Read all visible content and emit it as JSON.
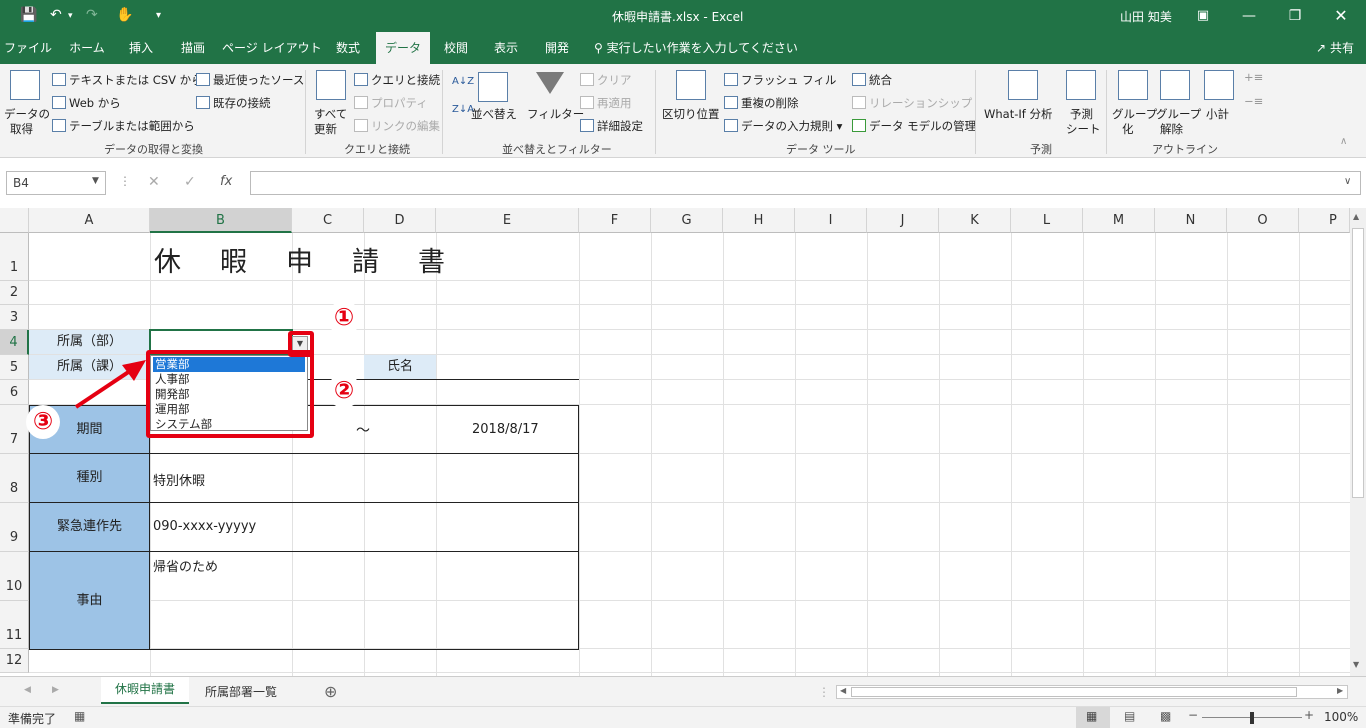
{
  "window": {
    "title": "休暇申請書.xlsx  -  Excel",
    "user": "山田 知美"
  },
  "qat": {
    "save_icon": "save-icon",
    "undo_icon": "undo-icon",
    "redo_icon": "redo-icon",
    "touch_icon": "touch-mode-icon",
    "customize_icon": "customize-icon"
  },
  "tabs": [
    "ファイル",
    "ホーム",
    "挿入",
    "描画",
    "ページ レイアウト",
    "数式",
    "データ",
    "校閲",
    "表示",
    "開発"
  ],
  "tell_me": "実行したい作業を入力してください",
  "share": "共有",
  "ribbon": {
    "get_data": {
      "label1": "データの",
      "label2": "取得"
    },
    "text_csv": "テキストまたは CSV から",
    "web": "Web から",
    "table_range": "テーブルまたは範囲から",
    "recent_sources": "最近使ったソース",
    "existing_conn": "既存の接続",
    "group_get": "データの取得と変換",
    "refresh_all": {
      "label1": "すべて",
      "label2": "更新"
    },
    "queries_conn": "クエリと接続",
    "properties": "プロパティ",
    "edit_links": "リンクの編集",
    "group_queries": "クエリと接続",
    "sort_az": "A↓Z",
    "sort_za": "Z↓A",
    "sort": "並べ替え",
    "filter": "フィルター",
    "clear": "クリア",
    "reapply": "再適用",
    "advanced": "詳細設定",
    "group_sort": "並べ替えとフィルター",
    "text_to_columns": "区切り位置",
    "flash_fill": "フラッシュ フィル",
    "remove_dup": "重複の削除",
    "data_validation": "データの入力規則",
    "consolidate": "統合",
    "relationships": "リレーションシップ",
    "data_model": "データ モデルの管理",
    "group_tools": "データ ツール",
    "what_if": "What-If 分析",
    "forecast": {
      "label1": "予測",
      "label2": "シート"
    },
    "group_forecast": "予測",
    "group_btn": {
      "label1": "グループ",
      "label2": "化"
    },
    "ungroup_btn": {
      "label1": "グループ",
      "label2": "解除"
    },
    "subtotal": "小計",
    "group_outline": "アウトライン"
  },
  "formula": {
    "name_box": "B4",
    "cancel": "✕",
    "enter": "✓",
    "fx": "fx",
    "value": ""
  },
  "columns": [
    "A",
    "B",
    "C",
    "D",
    "E",
    "F",
    "G",
    "H",
    "I",
    "J",
    "K",
    "L",
    "M",
    "N",
    "O",
    "P"
  ],
  "rows": [
    "1",
    "2",
    "3",
    "4",
    "5",
    "6",
    "7",
    "8",
    "9",
    "10",
    "11",
    "12"
  ],
  "cells": {
    "title": "休　暇　申　請　書",
    "dept_label": "所属（部）",
    "section_label": "所属（課）",
    "name_label": "氏名",
    "period_label": "期間",
    "period_sep": "～",
    "period_end": "2018/8/17",
    "type_label": "種別",
    "type_value": "特別休暇",
    "contact_label": "緊急連作先",
    "contact_value": "090-xxxx-yyyyy",
    "reason_label": "事由",
    "reason_value": "帰省のため"
  },
  "dropdown": {
    "items": [
      "営業部",
      "人事部",
      "開発部",
      "運用部",
      "システム部"
    ],
    "selected": "営業部"
  },
  "annotations": {
    "one": "①",
    "two": "②",
    "three": "③",
    "color": "#e50012"
  },
  "sheets": {
    "active": "休暇申請書",
    "other": "所属部署一覧",
    "add": "⊕"
  },
  "status": {
    "ready": "準備完了",
    "zoom": "100%"
  },
  "colors": {
    "excel_green": "#217346",
    "label_light": "#ddebf7",
    "label_blue": "#9dc3e6",
    "highlight": "#1e78d7"
  }
}
